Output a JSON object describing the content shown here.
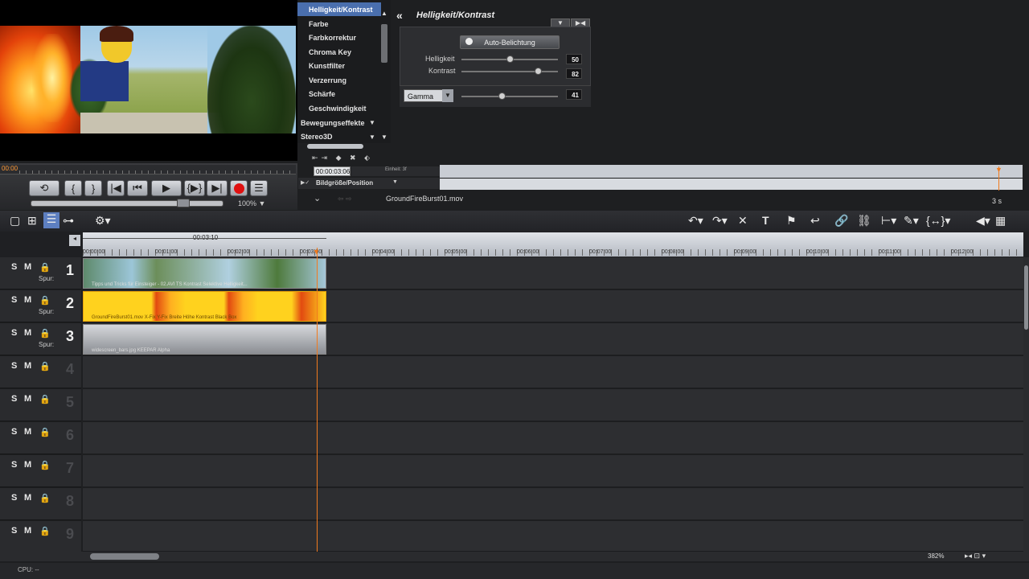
{
  "player": {
    "timecode": "00:00",
    "zoom": "100% ▼",
    "buttons": [
      "record-icon"
    ]
  },
  "effects": {
    "items": [
      "Helligkeit/Kontrast",
      "Farbe",
      "Farbkorrektur",
      "Chroma Key",
      "Kunstfilter",
      "Verzerrung",
      "Schärfe",
      "Geschwindigkeit",
      "Bewegungseffekte",
      "Stereo3D"
    ],
    "panel_title": "Helligkeit/Kontrast",
    "auto_label": "Auto-Belichtung",
    "helligkeit_label": "Helligkeit",
    "helligkeit_value": "50",
    "kontrast_label": "Kontrast",
    "kontrast_value": "82",
    "gamma_label": "Gamma",
    "gamma_value": "41"
  },
  "keyframes": {
    "timecode": "00:00:03:06",
    "einheit": "Einheit: 3f",
    "row_label": "Bildgröße/Position",
    "file": "GroundFireBurst01.mov",
    "span": "3 s"
  },
  "timeline": {
    "duration": "00:03:10",
    "ruler": [
      "00:00:00",
      "00:01:00",
      "00:02:00",
      "00:03:00",
      "00:04:00",
      "00:05:00",
      "00:06:00",
      "00:07:00",
      "00:08:00",
      "00:09:00",
      "00:10:00",
      "00:11:00",
      "00:12:00"
    ],
    "spur": "Spur:",
    "tracks": [
      "1",
      "2",
      "3",
      "4",
      "5",
      "6",
      "7",
      "8",
      "9"
    ],
    "clip1_label": "Tipps und Tricks für Einsteiger - 02.AVI TS  Kontrast  Selektive Helligkeit...",
    "clip2_label": "GroundFireBurst01.mov  X-Fix  Y-Fix  Breite  Höhe  Kontrast  Black Box",
    "clip3_label": "widescreen_bars.jpg  KEEPAR Alpha",
    "zoom": "382%",
    "cpu": "CPU: --"
  }
}
